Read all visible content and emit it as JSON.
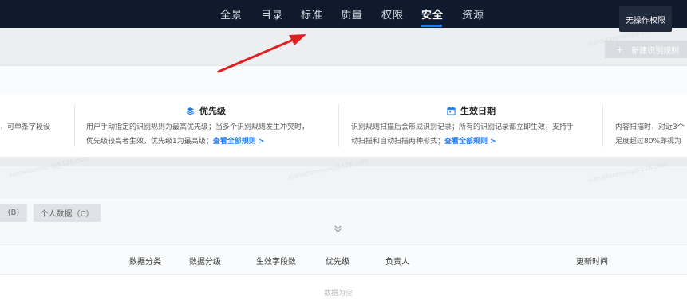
{
  "nav": {
    "items": [
      "全景",
      "目录",
      "标准",
      "质量",
      "权限",
      "安全",
      "资源"
    ],
    "active": "安全"
  },
  "tooltip": {
    "text": "无操作权限"
  },
  "toolbar": {
    "new_rule_plus": "+",
    "new_rule_label": "新建识别规则"
  },
  "cards": {
    "card1": {
      "line1": "，可单条字段设"
    },
    "card2": {
      "title": "优先级",
      "icon": "layers-icon",
      "line1": "用户手动指定的识别规则为最高优先级；当多个识别规则发生冲突时，",
      "line2": "优先级较高者生效，优先级1为最高级；",
      "link": "查看全部规则 >"
    },
    "card3": {
      "title": "生效日期",
      "icon": "calendar-icon",
      "line1": "识别规则扫描后会形成识别记录；所有的识别记录都立即生效，支持手",
      "line2": "动扫描和自动扫描两种形式；",
      "link": "查看全部规则 >"
    },
    "card4": {
      "line1": "内容扫描时，对近3个",
      "line2": "足度超过80%即视为"
    }
  },
  "tabs": [
    "(B)",
    "个人数据（C）"
  ],
  "expand_icon": "double-chevron-down-icon",
  "table": {
    "columns": [
      "数据分类",
      "数据分级",
      "生效字段数",
      "优先级",
      "负责人",
      "更新时间"
    ],
    "empty_text": "数据为空"
  },
  "watermark": "xianaifanmeng@126.com",
  "colors": {
    "nav_bg": "#0f1b2d",
    "accent": "#1f7cff",
    "arrow": "#e02020"
  }
}
